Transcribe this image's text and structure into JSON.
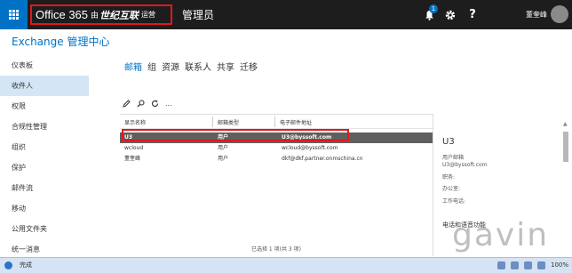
{
  "topbar": {
    "brand_office": "Office 365",
    "brand_by": "由",
    "brand_company": "世纪互联",
    "brand_operated": "运营",
    "admin_title": "管理员",
    "notification_count": "1",
    "help_label": "?",
    "username": "董奎峰"
  },
  "app_title": "Exchange 管理中心",
  "sidebar": {
    "items": [
      {
        "label": "仪表板"
      },
      {
        "label": "收件人"
      },
      {
        "label": "权限"
      },
      {
        "label": "合规性管理"
      },
      {
        "label": "组织"
      },
      {
        "label": "保护"
      },
      {
        "label": "邮件流"
      },
      {
        "label": "移动"
      },
      {
        "label": "公用文件夹"
      },
      {
        "label": "统一消息"
      }
    ],
    "active_index": 1
  },
  "tabs": [
    {
      "label": "邮箱"
    },
    {
      "label": "组"
    },
    {
      "label": "资源"
    },
    {
      "label": "联系人"
    },
    {
      "label": "共享"
    },
    {
      "label": "迁移"
    }
  ],
  "toolbar": {
    "more_label": "..."
  },
  "list": {
    "columns": [
      "显示名称",
      "邮箱类型",
      "电子邮件地址"
    ],
    "rows": [
      {
        "name": "U3",
        "type": "用户",
        "email": "U3@byssoft.com",
        "selected": true
      },
      {
        "name": "wcloud",
        "type": "用户",
        "email": "wcloud@byssoft.com",
        "selected": false
      },
      {
        "name": "董奎峰",
        "type": "用户",
        "email": "dkf@dkf.partner.onmschina.cn",
        "selected": false
      }
    ],
    "status": "已选择 1 项(共 3 项)"
  },
  "detail": {
    "name": "U3",
    "mailbox_label": "用户邮箱",
    "email": "U3@byssoft.com",
    "title_label": "职务:",
    "office_label": "办公室:",
    "phone_label": "工作电话:",
    "section_label": "电话和语音功能"
  },
  "watermark": "gavin",
  "statusbar": {
    "text": "完成",
    "zoom": "100%"
  },
  "colors": {
    "accent": "#0072c6",
    "topbar": "#1d1d1d",
    "highlight": "#e0191c",
    "selected_row": "#5f5f5f"
  }
}
